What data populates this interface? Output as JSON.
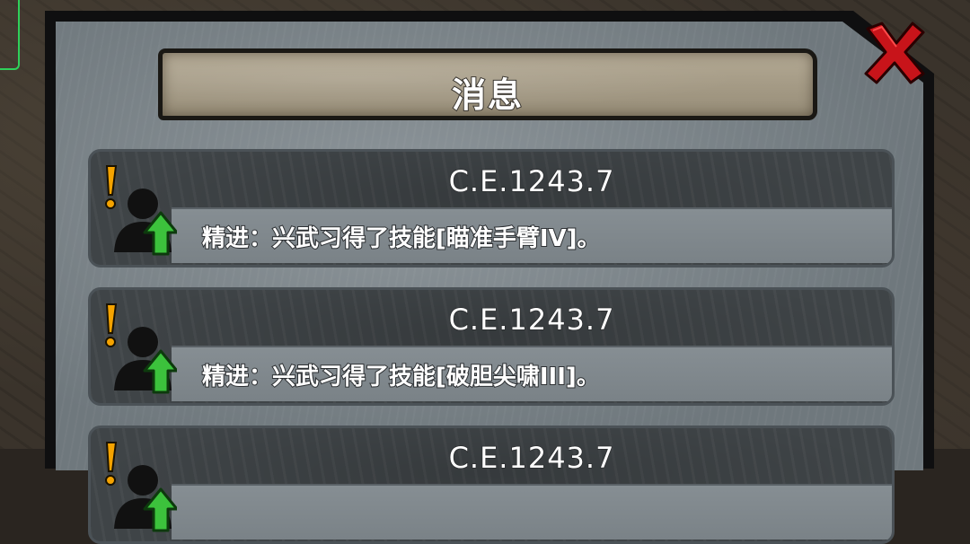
{
  "dialog": {
    "title": "消息",
    "close_icon": "close-x-icon"
  },
  "messages": [
    {
      "date": "C.E.1243.7",
      "text": "精进：兴武习得了技能[瞄准手臂IV]。",
      "icon": "skill-upgrade-icon"
    },
    {
      "date": "C.E.1243.7",
      "text": "精进：兴武习得了技能[破胆尖啸III]。",
      "icon": "skill-upgrade-icon"
    },
    {
      "date": "C.E.1243.7",
      "text": "",
      "icon": "skill-upgrade-icon"
    }
  ],
  "colors": {
    "close_red": "#c8141a",
    "arrow_green": "#3cc23c",
    "alert_orange": "#f5a300"
  }
}
